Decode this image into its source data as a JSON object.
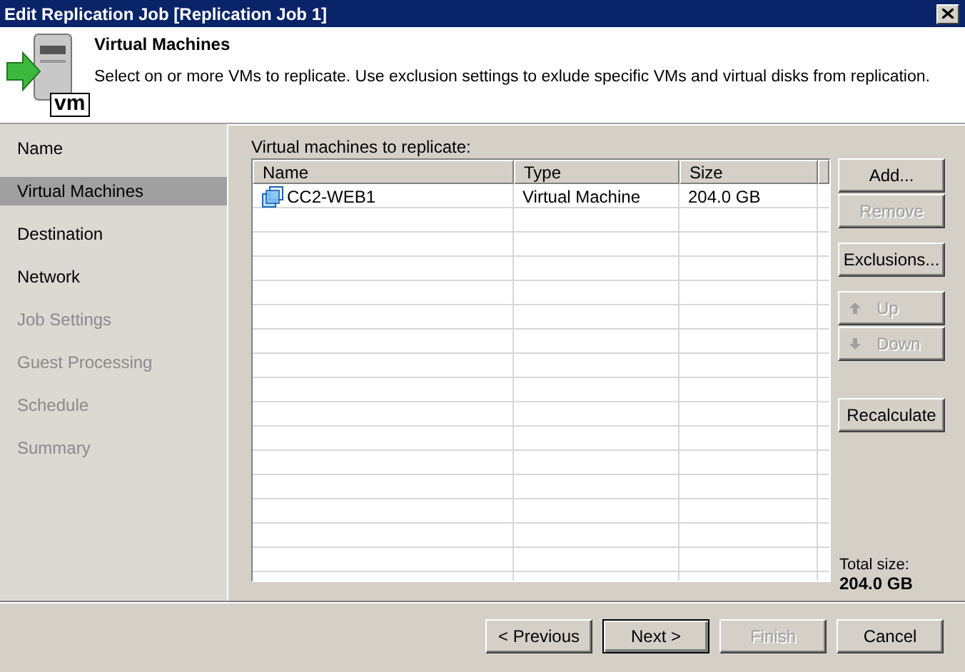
{
  "window": {
    "title": "Edit Replication Job [Replication Job 1]"
  },
  "header": {
    "title": "Virtual Machines",
    "description": "Select on or more VMs to replicate. Use exclusion settings to exlude specific VMs and virtual disks from replication.",
    "icon_badge": "vm"
  },
  "sidebar": {
    "items": [
      {
        "label": "Name",
        "selected": false,
        "disabled": false
      },
      {
        "label": "Virtual Machines",
        "selected": true,
        "disabled": false
      },
      {
        "label": "Destination",
        "selected": false,
        "disabled": false
      },
      {
        "label": "Network",
        "selected": false,
        "disabled": false
      },
      {
        "label": "Job Settings",
        "selected": false,
        "disabled": true
      },
      {
        "label": "Guest Processing",
        "selected": false,
        "disabled": true
      },
      {
        "label": "Schedule",
        "selected": false,
        "disabled": true
      },
      {
        "label": "Summary",
        "selected": false,
        "disabled": true
      }
    ]
  },
  "vm_list": {
    "label": "Virtual machines to replicate:",
    "columns": [
      "Name",
      "Type",
      "Size"
    ],
    "rows": [
      {
        "name": "CC2-WEB1",
        "type": "Virtual Machine",
        "size": "204.0 GB"
      }
    ]
  },
  "side_buttons": [
    {
      "label": "Add...",
      "disabled": false,
      "kind": "plain"
    },
    {
      "label": "Remove",
      "disabled": true,
      "kind": "plain"
    },
    {
      "label": "Exclusions...",
      "disabled": false,
      "kind": "plain"
    },
    {
      "label": "Up",
      "disabled": true,
      "kind": "up"
    },
    {
      "label": "Down",
      "disabled": true,
      "kind": "down"
    },
    {
      "label": "Recalculate",
      "disabled": false,
      "kind": "plain"
    }
  ],
  "total": {
    "label": "Total size:",
    "value": "204.0 GB"
  },
  "footer_buttons": [
    {
      "label": "< Previous",
      "disabled": false,
      "default": false
    },
    {
      "label": "Next >",
      "disabled": false,
      "default": true
    },
    {
      "label": "Finish",
      "disabled": true,
      "default": false
    },
    {
      "label": "Cancel",
      "disabled": false,
      "default": false
    }
  ]
}
